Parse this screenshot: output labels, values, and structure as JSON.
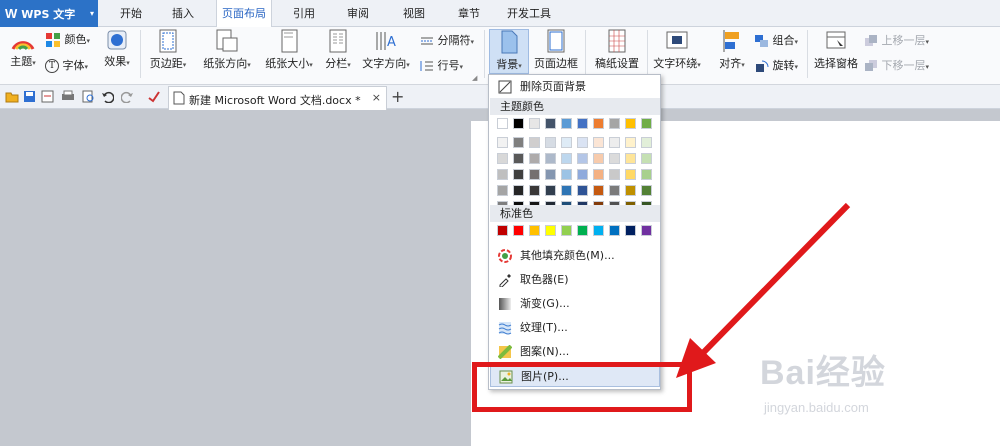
{
  "app": {
    "title": "WPS 文字"
  },
  "tabs": [
    "开始",
    "插入",
    "页面布局",
    "引用",
    "审阅",
    "视图",
    "章节",
    "开发工具"
  ],
  "ribbon": {
    "theme": "主题",
    "color": "颜色",
    "font": "字体",
    "effect": "效果",
    "margins": "页边距",
    "orientation": "纸张方向",
    "size": "纸张大小",
    "columns": "分栏",
    "text_direction": "文字方向",
    "separator": "分隔符",
    "line_number": "行号",
    "background": "背景",
    "page_border": "页面边框",
    "manuscript": "稿纸设置",
    "text_wrap": "文字环绕",
    "align": "对齐",
    "group": "组合",
    "rotate": "旋转",
    "selection_pane": "选择窗格",
    "bring_forward": "上移一层",
    "send_backward": "下移一层"
  },
  "document_tab": {
    "title": "新建 Microsoft Word 文档.docx *",
    "close": "×",
    "new": "+"
  },
  "menu": {
    "remove_background": "删除页面背景",
    "theme_colors_header": "主题颜色",
    "standard_colors_header": "标准色",
    "more_fill": "其他填充颜色(M)...",
    "eyedropper": "取色器(E)",
    "gradient": "渐变(G)...",
    "texture": "纹理(T)...",
    "pattern": "图案(N)...",
    "picture": "图片(P)..."
  },
  "colors": {
    "theme_top": [
      "#ffffff",
      "#000000",
      "#e7e6e6",
      "#44546a",
      "#5b9bd5",
      "#4472c4",
      "#ed7d31",
      "#a5a5a5",
      "#ffc000",
      "#70ad47"
    ],
    "theme_shades": [
      [
        "#f2f2f2",
        "#7f7f7f",
        "#d0cece",
        "#d6dce4",
        "#deebf6",
        "#dae3f3",
        "#fbe5d5",
        "#ededed",
        "#fff2cc",
        "#e2efd9"
      ],
      [
        "#d8d8d8",
        "#595959",
        "#aeabab",
        "#adb9ca",
        "#bdd7ee",
        "#b4c6e7",
        "#f7cbac",
        "#dbdbdb",
        "#fee599",
        "#c5e0b3"
      ],
      [
        "#bfbfbf",
        "#3f3f3f",
        "#757070",
        "#8496b0",
        "#9cc3e5",
        "#8faadc",
        "#f4b183",
        "#c9c9c9",
        "#ffd965",
        "#a8d08d"
      ],
      [
        "#a5a5a5",
        "#262626",
        "#3a3838",
        "#323f4f",
        "#2e75b5",
        "#2f5496",
        "#c55a11",
        "#7b7b7b",
        "#bf9000",
        "#538135"
      ],
      [
        "#7f7f7f",
        "#0c0c0c",
        "#171616",
        "#222a35",
        "#1e4e79",
        "#203864",
        "#833c0b",
        "#525252",
        "#7f6000",
        "#375623"
      ]
    ],
    "standard": [
      "#c00000",
      "#ff0000",
      "#ffc000",
      "#ffff00",
      "#92d050",
      "#00b050",
      "#00b0f0",
      "#0070c0",
      "#002060",
      "#7030a0"
    ],
    "annotation_red": "#e0191b"
  },
  "watermark": {
    "brand": "Bai经验",
    "url": "jingyan.baidu.com"
  }
}
